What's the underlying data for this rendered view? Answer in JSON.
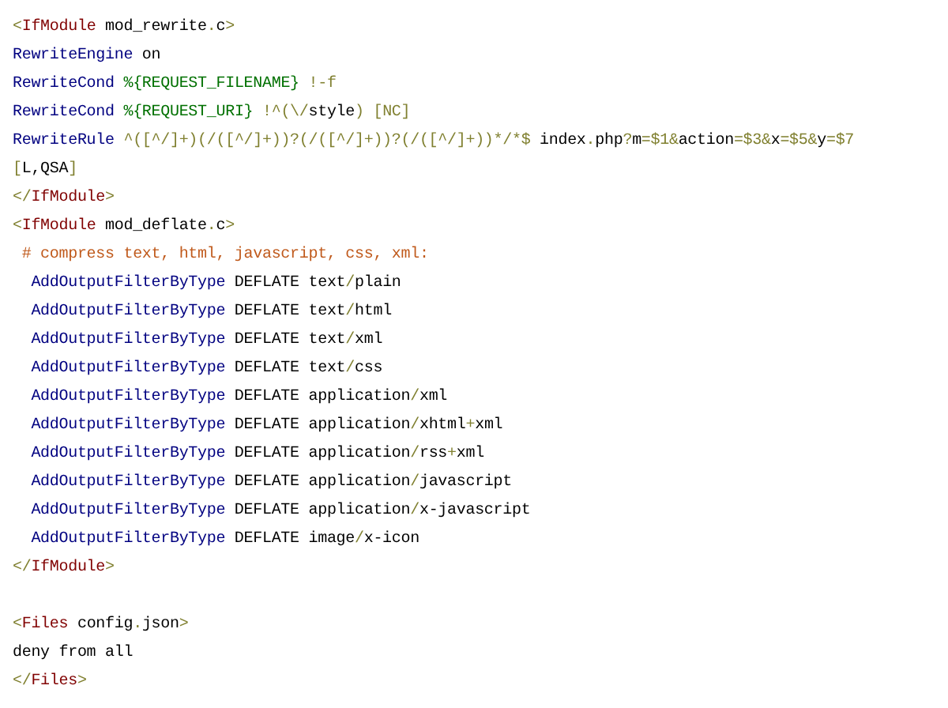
{
  "blocks": [
    {
      "code_lines": [
        {
          "tokens": [
            {
              "kind": "punct",
              "text": "<"
            },
            {
              "kind": "tag",
              "text": "IfModule"
            },
            {
              "kind": "plain",
              "text": " mod_rewrite"
            },
            {
              "kind": "punct",
              "text": "."
            },
            {
              "kind": "plain",
              "text": "c"
            },
            {
              "kind": "punct",
              "text": ">"
            }
          ]
        },
        {
          "tokens": [
            {
              "kind": "keyword",
              "text": "RewriteEngine"
            },
            {
              "kind": "plain",
              "text": " on"
            }
          ]
        },
        {
          "tokens": [
            {
              "kind": "keyword",
              "text": "RewriteCond"
            },
            {
              "kind": "variable",
              "text": " %{REQUEST_FILENAME}"
            },
            {
              "kind": "punct",
              "text": " !-f"
            }
          ]
        },
        {
          "tokens": [
            {
              "kind": "keyword",
              "text": "RewriteCond"
            },
            {
              "kind": "variable",
              "text": " %{REQUEST_URI}"
            },
            {
              "kind": "punct",
              "text": " !^(\\/"
            },
            {
              "kind": "plain",
              "text": "style"
            },
            {
              "kind": "punct",
              "text": ") [NC]"
            }
          ]
        },
        {
          "tokens": [
            {
              "kind": "keyword",
              "text": "RewriteRule"
            },
            {
              "kind": "punct",
              "text": " ^([^/]+)(/([^/]+))?(/([^/]+))?(/([^/]+))*/*$"
            },
            {
              "kind": "plain",
              "text": " index"
            },
            {
              "kind": "punct",
              "text": "."
            },
            {
              "kind": "plain",
              "text": "php"
            },
            {
              "kind": "punct",
              "text": "?"
            },
            {
              "kind": "plain",
              "text": "m"
            },
            {
              "kind": "punct",
              "text": "=$1&"
            },
            {
              "kind": "plain",
              "text": "action"
            },
            {
              "kind": "punct",
              "text": "=$3&"
            },
            {
              "kind": "plain",
              "text": "x"
            },
            {
              "kind": "punct",
              "text": "=$5&"
            },
            {
              "kind": "plain",
              "text": "y"
            },
            {
              "kind": "punct",
              "text": "=$7"
            }
          ]
        },
        {
          "tokens": [
            {
              "kind": "punct",
              "text": "["
            },
            {
              "kind": "plain",
              "text": "L,QSA"
            },
            {
              "kind": "punct",
              "text": "]"
            }
          ]
        },
        {
          "tokens": [
            {
              "kind": "punct",
              "text": "</"
            },
            {
              "kind": "tag",
              "text": "IfModule"
            },
            {
              "kind": "punct",
              "text": ">"
            }
          ]
        },
        {
          "tokens": [
            {
              "kind": "punct",
              "text": "<"
            },
            {
              "kind": "tag",
              "text": "IfModule"
            },
            {
              "kind": "plain",
              "text": " mod_deflate"
            },
            {
              "kind": "punct",
              "text": "."
            },
            {
              "kind": "plain",
              "text": "c"
            },
            {
              "kind": "punct",
              "text": ">"
            }
          ]
        },
        {
          "tokens": [
            {
              "kind": "comment",
              "text": " # compress text, html, javascript, css, xml:"
            }
          ]
        },
        {
          "tokens": [
            {
              "kind": "keyword",
              "text": "  AddOutputFilterByType"
            },
            {
              "kind": "plain",
              "text": " DEFLATE text"
            },
            {
              "kind": "punct",
              "text": "/"
            },
            {
              "kind": "plain",
              "text": "plain"
            }
          ]
        },
        {
          "tokens": [
            {
              "kind": "keyword",
              "text": "  AddOutputFilterByType"
            },
            {
              "kind": "plain",
              "text": " DEFLATE text"
            },
            {
              "kind": "punct",
              "text": "/"
            },
            {
              "kind": "plain",
              "text": "html"
            }
          ]
        },
        {
          "tokens": [
            {
              "kind": "keyword",
              "text": "  AddOutputFilterByType"
            },
            {
              "kind": "plain",
              "text": " DEFLATE text"
            },
            {
              "kind": "punct",
              "text": "/"
            },
            {
              "kind": "plain",
              "text": "xml"
            }
          ]
        },
        {
          "tokens": [
            {
              "kind": "keyword",
              "text": "  AddOutputFilterByType"
            },
            {
              "kind": "plain",
              "text": " DEFLATE text"
            },
            {
              "kind": "punct",
              "text": "/"
            },
            {
              "kind": "plain",
              "text": "css"
            }
          ]
        },
        {
          "tokens": [
            {
              "kind": "keyword",
              "text": "  AddOutputFilterByType"
            },
            {
              "kind": "plain",
              "text": " DEFLATE application"
            },
            {
              "kind": "punct",
              "text": "/"
            },
            {
              "kind": "plain",
              "text": "xml"
            }
          ]
        },
        {
          "tokens": [
            {
              "kind": "keyword",
              "text": "  AddOutputFilterByType"
            },
            {
              "kind": "plain",
              "text": " DEFLATE application"
            },
            {
              "kind": "punct",
              "text": "/"
            },
            {
              "kind": "plain",
              "text": "xhtml"
            },
            {
              "kind": "punct",
              "text": "+"
            },
            {
              "kind": "plain",
              "text": "xml"
            }
          ]
        },
        {
          "tokens": [
            {
              "kind": "keyword",
              "text": "  AddOutputFilterByType"
            },
            {
              "kind": "plain",
              "text": " DEFLATE application"
            },
            {
              "kind": "punct",
              "text": "/"
            },
            {
              "kind": "plain",
              "text": "rss"
            },
            {
              "kind": "punct",
              "text": "+"
            },
            {
              "kind": "plain",
              "text": "xml"
            }
          ]
        },
        {
          "tokens": [
            {
              "kind": "keyword",
              "text": "  AddOutputFilterByType"
            },
            {
              "kind": "plain",
              "text": " DEFLATE application"
            },
            {
              "kind": "punct",
              "text": "/"
            },
            {
              "kind": "plain",
              "text": "javascript"
            }
          ]
        },
        {
          "tokens": [
            {
              "kind": "keyword",
              "text": "  AddOutputFilterByType"
            },
            {
              "kind": "plain",
              "text": " DEFLATE application"
            },
            {
              "kind": "punct",
              "text": "/"
            },
            {
              "kind": "plain",
              "text": "x-javascript"
            }
          ]
        },
        {
          "tokens": [
            {
              "kind": "keyword",
              "text": "  AddOutputFilterByType"
            },
            {
              "kind": "plain",
              "text": " DEFLATE image"
            },
            {
              "kind": "punct",
              "text": "/"
            },
            {
              "kind": "plain",
              "text": "x-icon"
            }
          ]
        },
        {
          "tokens": [
            {
              "kind": "punct",
              "text": "</"
            },
            {
              "kind": "tag",
              "text": "IfModule"
            },
            {
              "kind": "punct",
              "text": ">"
            }
          ]
        }
      ]
    },
    {
      "code_lines": [
        {
          "tokens": [
            {
              "kind": "punct",
              "text": "<"
            },
            {
              "kind": "tag",
              "text": "Files"
            },
            {
              "kind": "plain",
              "text": " config"
            },
            {
              "kind": "punct",
              "text": "."
            },
            {
              "kind": "plain",
              "text": "json"
            },
            {
              "kind": "punct",
              "text": ">"
            }
          ]
        },
        {
          "tokens": [
            {
              "kind": "plain",
              "text": "deny from all"
            }
          ]
        },
        {
          "tokens": [
            {
              "kind": "punct",
              "text": "</"
            },
            {
              "kind": "tag",
              "text": "Files"
            },
            {
              "kind": "punct",
              "text": ">"
            }
          ]
        }
      ]
    }
  ]
}
